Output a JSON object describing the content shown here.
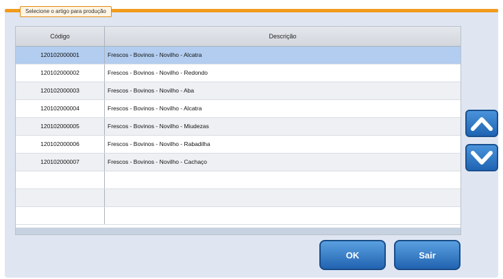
{
  "tab": {
    "label": "Selecione o artigo para produção"
  },
  "table": {
    "columns": [
      "Código",
      "Descrição"
    ],
    "rows": [
      {
        "code": "120102000001",
        "desc": "Frescos - Bovinos - Novilho - Alcatra"
      },
      {
        "code": "120102000002",
        "desc": "Frescos - Bovinos - Novilho - Redondo"
      },
      {
        "code": "120102000003",
        "desc": "Frescos - Bovinos - Novilho - Aba"
      },
      {
        "code": "120102000004",
        "desc": "Frescos - Bovinos - Novilho - Alcatra"
      },
      {
        "code": "120102000005",
        "desc": "Frescos - Bovinos - Novilho - Miudezas"
      },
      {
        "code": "120102000006",
        "desc": "Frescos - Bovinos - Novilho - Rabadilha"
      },
      {
        "code": "120102000007",
        "desc": "Frescos - Bovinos - Novilho - Cachaço"
      },
      {
        "code": "",
        "desc": ""
      },
      {
        "code": "",
        "desc": ""
      },
      {
        "code": "",
        "desc": ""
      }
    ]
  },
  "buttons": {
    "ok": "OK",
    "exit": "Sair"
  },
  "icons": {
    "scroll_up": "chevron-up-icon",
    "scroll_down": "chevron-down-icon"
  },
  "colors": {
    "accent": "#f29b1d",
    "button": "#2163b0",
    "selected_row": "#b2cdef",
    "panel": "#dfe6f2"
  }
}
